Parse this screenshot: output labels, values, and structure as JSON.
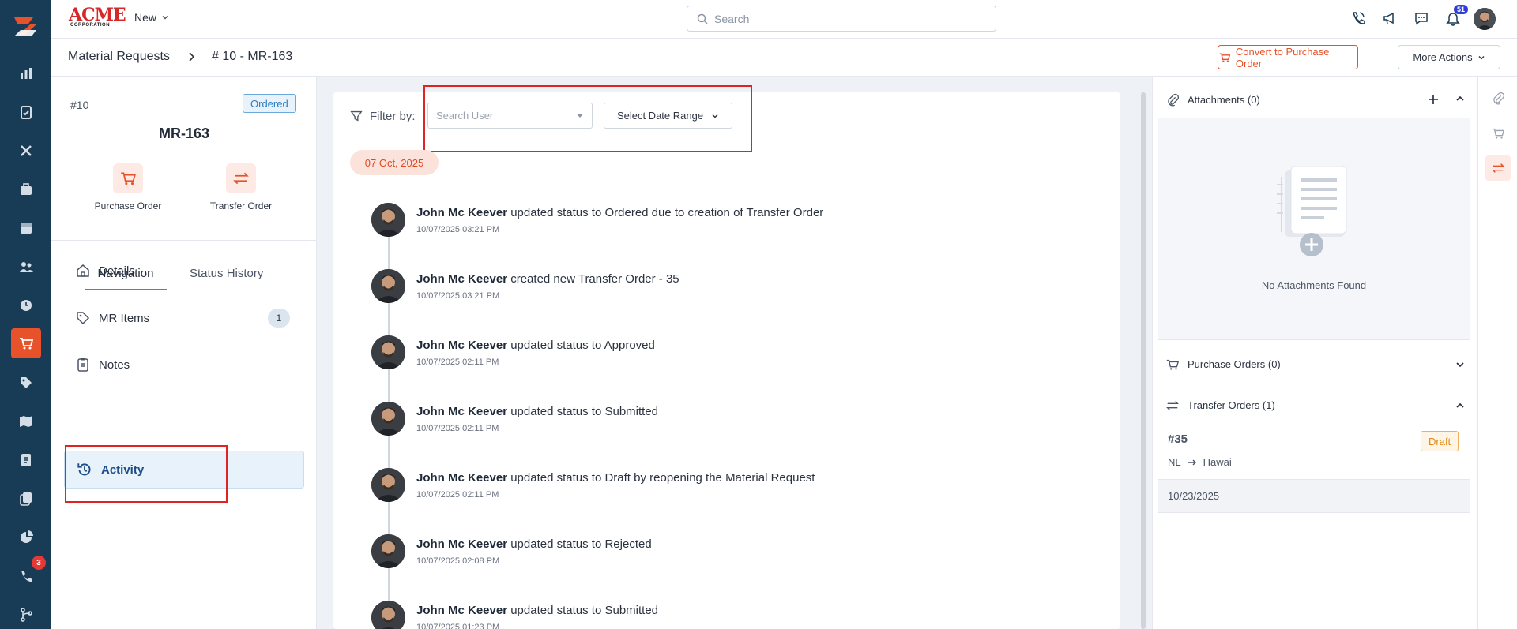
{
  "app": {
    "brand_main": "ACME",
    "brand_sub": "CORPORATION",
    "new_label": "New",
    "search_placeholder": "Search",
    "notification_count": "51",
    "accent_color": "#e8522a",
    "rail_color": "#183b56"
  },
  "rail": {
    "items": [
      {
        "icon": "bar-chart-icon"
      },
      {
        "icon": "clipboard-check-icon"
      },
      {
        "icon": "tools-icon"
      },
      {
        "icon": "briefcase-icon"
      },
      {
        "icon": "calendar-icon"
      },
      {
        "icon": "users-icon"
      },
      {
        "icon": "clock-icon"
      },
      {
        "icon": "cart-icon",
        "active": true
      },
      {
        "icon": "tag-icon"
      },
      {
        "icon": "map-icon"
      },
      {
        "icon": "document-icon"
      },
      {
        "icon": "copy-icon"
      },
      {
        "icon": "pie-chart-icon"
      },
      {
        "icon": "phone-call-icon",
        "badge": "3"
      },
      {
        "icon": "git-branch-icon"
      }
    ]
  },
  "breadcrumb": {
    "parent": "Material Requests",
    "current": "# 10 - MR-163"
  },
  "actions": {
    "convert_label": "Convert to Purchase Order",
    "more_label": "More Actions"
  },
  "record": {
    "number": "#10",
    "status": "Ordered",
    "title": "MR-163",
    "quick_actions": [
      {
        "label": "Purchase Order",
        "icon": "cart-dollar-icon"
      },
      {
        "label": "Transfer Order",
        "icon": "transfer-arrows-icon"
      }
    ]
  },
  "tabs": {
    "navigation": "Navigation",
    "status_history": "Status History"
  },
  "nav": {
    "details": "Details",
    "mr_items": "MR Items",
    "mr_items_count": "1",
    "notes": "Notes",
    "activity": "Activity"
  },
  "filter": {
    "label": "Filter by:",
    "user_placeholder": "Search User",
    "date_label": "Select Date Range"
  },
  "activity": {
    "date_chip": "07 Oct, 2025",
    "entries": [
      {
        "user": "John Mc Keever",
        "text": "updated status to Ordered due to creation of Transfer Order",
        "time": "10/07/2025 03:21 PM"
      },
      {
        "user": "John Mc Keever",
        "text": "created new Transfer Order - 35",
        "time": "10/07/2025 03:21 PM"
      },
      {
        "user": "John Mc Keever",
        "text": "updated status to Approved",
        "time": "10/07/2025 02:11 PM"
      },
      {
        "user": "John Mc Keever",
        "text": "updated status to Submitted",
        "time": "10/07/2025 02:11 PM"
      },
      {
        "user": "John Mc Keever",
        "text": "updated status to Draft by reopening the Material Request",
        "time": "10/07/2025 02:11 PM"
      },
      {
        "user": "John Mc Keever",
        "text": "updated status to Rejected",
        "time": "10/07/2025 02:08 PM"
      },
      {
        "user": "John Mc Keever",
        "text": "updated status to Submitted",
        "time": "10/07/2025 01:23 PM"
      }
    ]
  },
  "right": {
    "attachments_title": "Attachments (0)",
    "no_attachments": "No Attachments Found",
    "purchase_orders_title": "Purchase Orders (0)",
    "transfer_orders_title": "Transfer Orders (1)",
    "transfer_order": {
      "number": "#35",
      "status": "Draft",
      "from": "NL",
      "to": "Hawai",
      "date": "10/23/2025"
    }
  }
}
